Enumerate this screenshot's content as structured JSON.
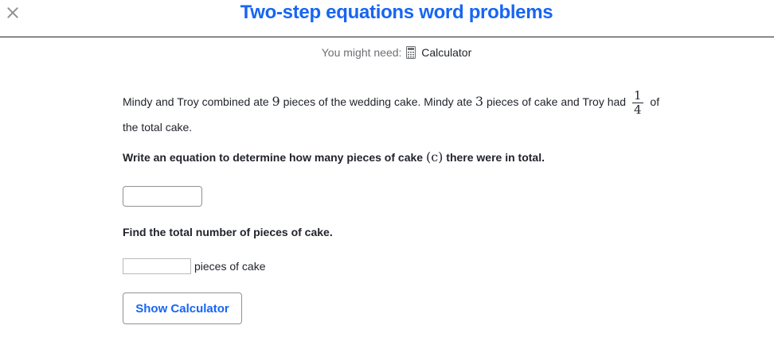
{
  "header": {
    "title": "Two-step equations word problems"
  },
  "tools": {
    "prefix": "You might need:",
    "calculator_label": "Calculator"
  },
  "problem": {
    "text1": "Mindy and Troy combined ate ",
    "num_total": "9",
    "text2": " pieces of the wedding cake. Mindy ate ",
    "num_mindy": "3",
    "text3": " pieces of cake and Troy had ",
    "frac_num": "1",
    "frac_den": "4",
    "text4": " of the total cake."
  },
  "question1": {
    "text1": "Write an equation to determine how many pieces of cake ",
    "var": "(c)",
    "text2": " there were in total."
  },
  "question2": {
    "text": "Find the total number of pieces of cake."
  },
  "answer": {
    "unit": "pieces of cake"
  },
  "buttons": {
    "show_calculator": "Show Calculator"
  },
  "colors": {
    "accent": "#1865f2",
    "text": "#21242c",
    "muted": "#6d6f74",
    "border": "#8f9196"
  }
}
